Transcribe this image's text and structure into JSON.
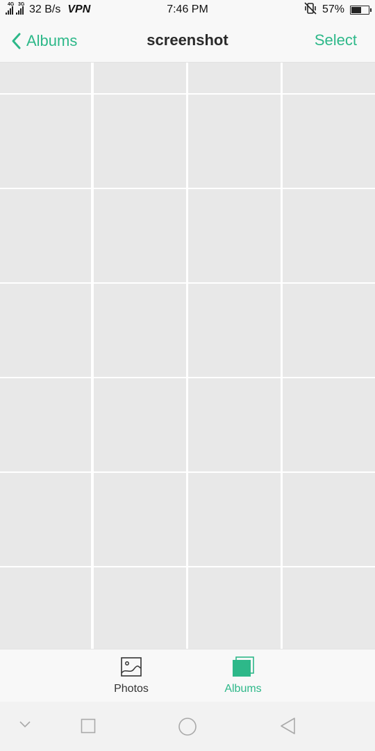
{
  "status_bar": {
    "network1": "4G",
    "network2": "3G",
    "speed": "32 B/s",
    "vpn": "VPN",
    "time": "7:46 PM",
    "battery_percent": "57%",
    "battery_level": 0.57,
    "icons": [
      "signal-4g-icon",
      "signal-3g-icon",
      "vibrate-icon",
      "battery-icon"
    ]
  },
  "header": {
    "back_label": "Albums",
    "title": "screenshot",
    "select_label": "Select",
    "accent_color": "#2db889"
  },
  "grid": {
    "columns": 4,
    "rows_visible": 7,
    "placeholder_color": "#e8e8e8"
  },
  "tabs": [
    {
      "label": "Photos",
      "icon": "photo-icon",
      "active": false
    },
    {
      "label": "Albums",
      "icon": "albums-icon",
      "active": true
    }
  ],
  "nav_bar": {
    "icons": [
      "hide-nav-icon",
      "recents-icon",
      "home-icon",
      "back-icon"
    ]
  }
}
